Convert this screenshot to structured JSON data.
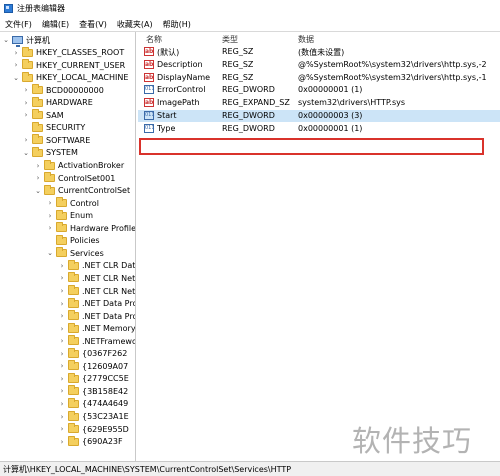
{
  "window": {
    "title": "注册表编辑器"
  },
  "menu": [
    "文件(F)",
    "编辑(E)",
    "查看(V)",
    "收藏夹(A)",
    "帮助(H)"
  ],
  "tree": [
    {
      "label": "计算机",
      "icon": "computer-icon",
      "expander": "expanded"
    },
    {
      "label": "HKEY_CLASSES_ROOT",
      "icon": "folder-icon",
      "expander": "collapsed"
    },
    {
      "label": "HKEY_CURRENT_USER",
      "icon": "folder-icon",
      "expander": "collapsed"
    },
    {
      "label": "HKEY_LOCAL_MACHINE",
      "icon": "folder-icon",
      "expander": "expanded"
    },
    {
      "label": "BCD00000000",
      "icon": "folder-icon",
      "expander": "collapsed"
    },
    {
      "label": "HARDWARE",
      "icon": "folder-icon",
      "expander": "collapsed"
    },
    {
      "label": "SAM",
      "icon": "folder-icon",
      "expander": "collapsed"
    },
    {
      "label": "SECURITY",
      "icon": "folder-icon",
      "expander": "none"
    },
    {
      "label": "SOFTWARE",
      "icon": "folder-icon",
      "expander": "collapsed"
    },
    {
      "label": "SYSTEM",
      "icon": "folder-icon",
      "expander": "expanded"
    },
    {
      "label": "ActivationBroker",
      "icon": "folder-icon",
      "expander": "collapsed"
    },
    {
      "label": "ControlSet001",
      "icon": "folder-icon",
      "expander": "collapsed"
    },
    {
      "label": "CurrentControlSet",
      "icon": "folder-icon",
      "expander": "expanded"
    },
    {
      "label": "Control",
      "icon": "folder-icon",
      "expander": "collapsed"
    },
    {
      "label": "Enum",
      "icon": "folder-icon",
      "expander": "collapsed"
    },
    {
      "label": "Hardware Profiles",
      "icon": "folder-icon",
      "expander": "collapsed"
    },
    {
      "label": "Policies",
      "icon": "folder-icon",
      "expander": "none"
    },
    {
      "label": "Services",
      "icon": "folder-icon",
      "expander": "expanded"
    },
    {
      "label": ".NET CLR Data",
      "icon": "folder-icon",
      "expander": "collapsed"
    },
    {
      "label": ".NET CLR Networking",
      "icon": "folder-icon",
      "expander": "collapsed"
    },
    {
      "label": ".NET CLR Networking 4.0.0.0",
      "icon": "folder-icon",
      "expander": "collapsed"
    },
    {
      "label": ".NET Data Provider for Oracle",
      "icon": "folder-icon",
      "expander": "collapsed"
    },
    {
      "label": ".NET Data Provider for SqlServer",
      "icon": "folder-icon",
      "expander": "collapsed"
    },
    {
      "label": ".NET Memory Cache 4.0",
      "icon": "folder-icon",
      "expander": "collapsed"
    },
    {
      "label": ".NETFramework",
      "icon": "folder-icon",
      "expander": "collapsed"
    },
    {
      "label": "{0367F262",
      "icon": "folder-icon",
      "expander": "collapsed"
    },
    {
      "label": "{12609A07",
      "icon": "folder-icon",
      "expander": "collapsed"
    },
    {
      "label": "{2779CC5E",
      "icon": "folder-icon",
      "expander": "collapsed"
    },
    {
      "label": "{3B158E42",
      "icon": "folder-icon",
      "expander": "collapsed"
    },
    {
      "label": "{474A4649",
      "icon": "folder-icon",
      "expander": "collapsed"
    },
    {
      "label": "{53C23A1E",
      "icon": "folder-icon",
      "expander": "collapsed"
    },
    {
      "label": "{629E955D",
      "icon": "folder-icon",
      "expander": "collapsed"
    },
    {
      "label": "{690A23F",
      "icon": "folder-icon",
      "expander": "collapsed"
    }
  ],
  "columns": {
    "name": "名称",
    "type": "类型",
    "data": "数据"
  },
  "values": [
    {
      "name": "(默认)",
      "type": "REG_SZ",
      "data": "(数值未设置)",
      "icon": "string-value-icon"
    },
    {
      "name": "Description",
      "type": "REG_SZ",
      "data": "@%SystemRoot%\\system32\\drivers\\http.sys,-2",
      "icon": "string-value-icon"
    },
    {
      "name": "DisplayName",
      "type": "REG_SZ",
      "data": "@%SystemRoot%\\system32\\drivers\\http.sys,-1",
      "icon": "string-value-icon"
    },
    {
      "name": "ErrorControl",
      "type": "REG_DWORD",
      "data": "0x00000001 (1)",
      "icon": "binary-value-icon"
    },
    {
      "name": "ImagePath",
      "type": "REG_EXPAND_SZ",
      "data": "system32\\drivers\\HTTP.sys",
      "icon": "string-value-icon"
    },
    {
      "name": "Start",
      "type": "REG_DWORD",
      "data": "0x00000003 (3)",
      "icon": "binary-value-icon",
      "selected": true
    },
    {
      "name": "Type",
      "type": "REG_DWORD",
      "data": "0x00000001 (1)",
      "icon": "binary-value-icon"
    }
  ],
  "status": {
    "path": "计算机\\HKEY_LOCAL_MACHINE\\SYSTEM\\CurrentControlSet\\Services\\HTTP"
  },
  "watermark": {
    "text": "软件技巧"
  }
}
